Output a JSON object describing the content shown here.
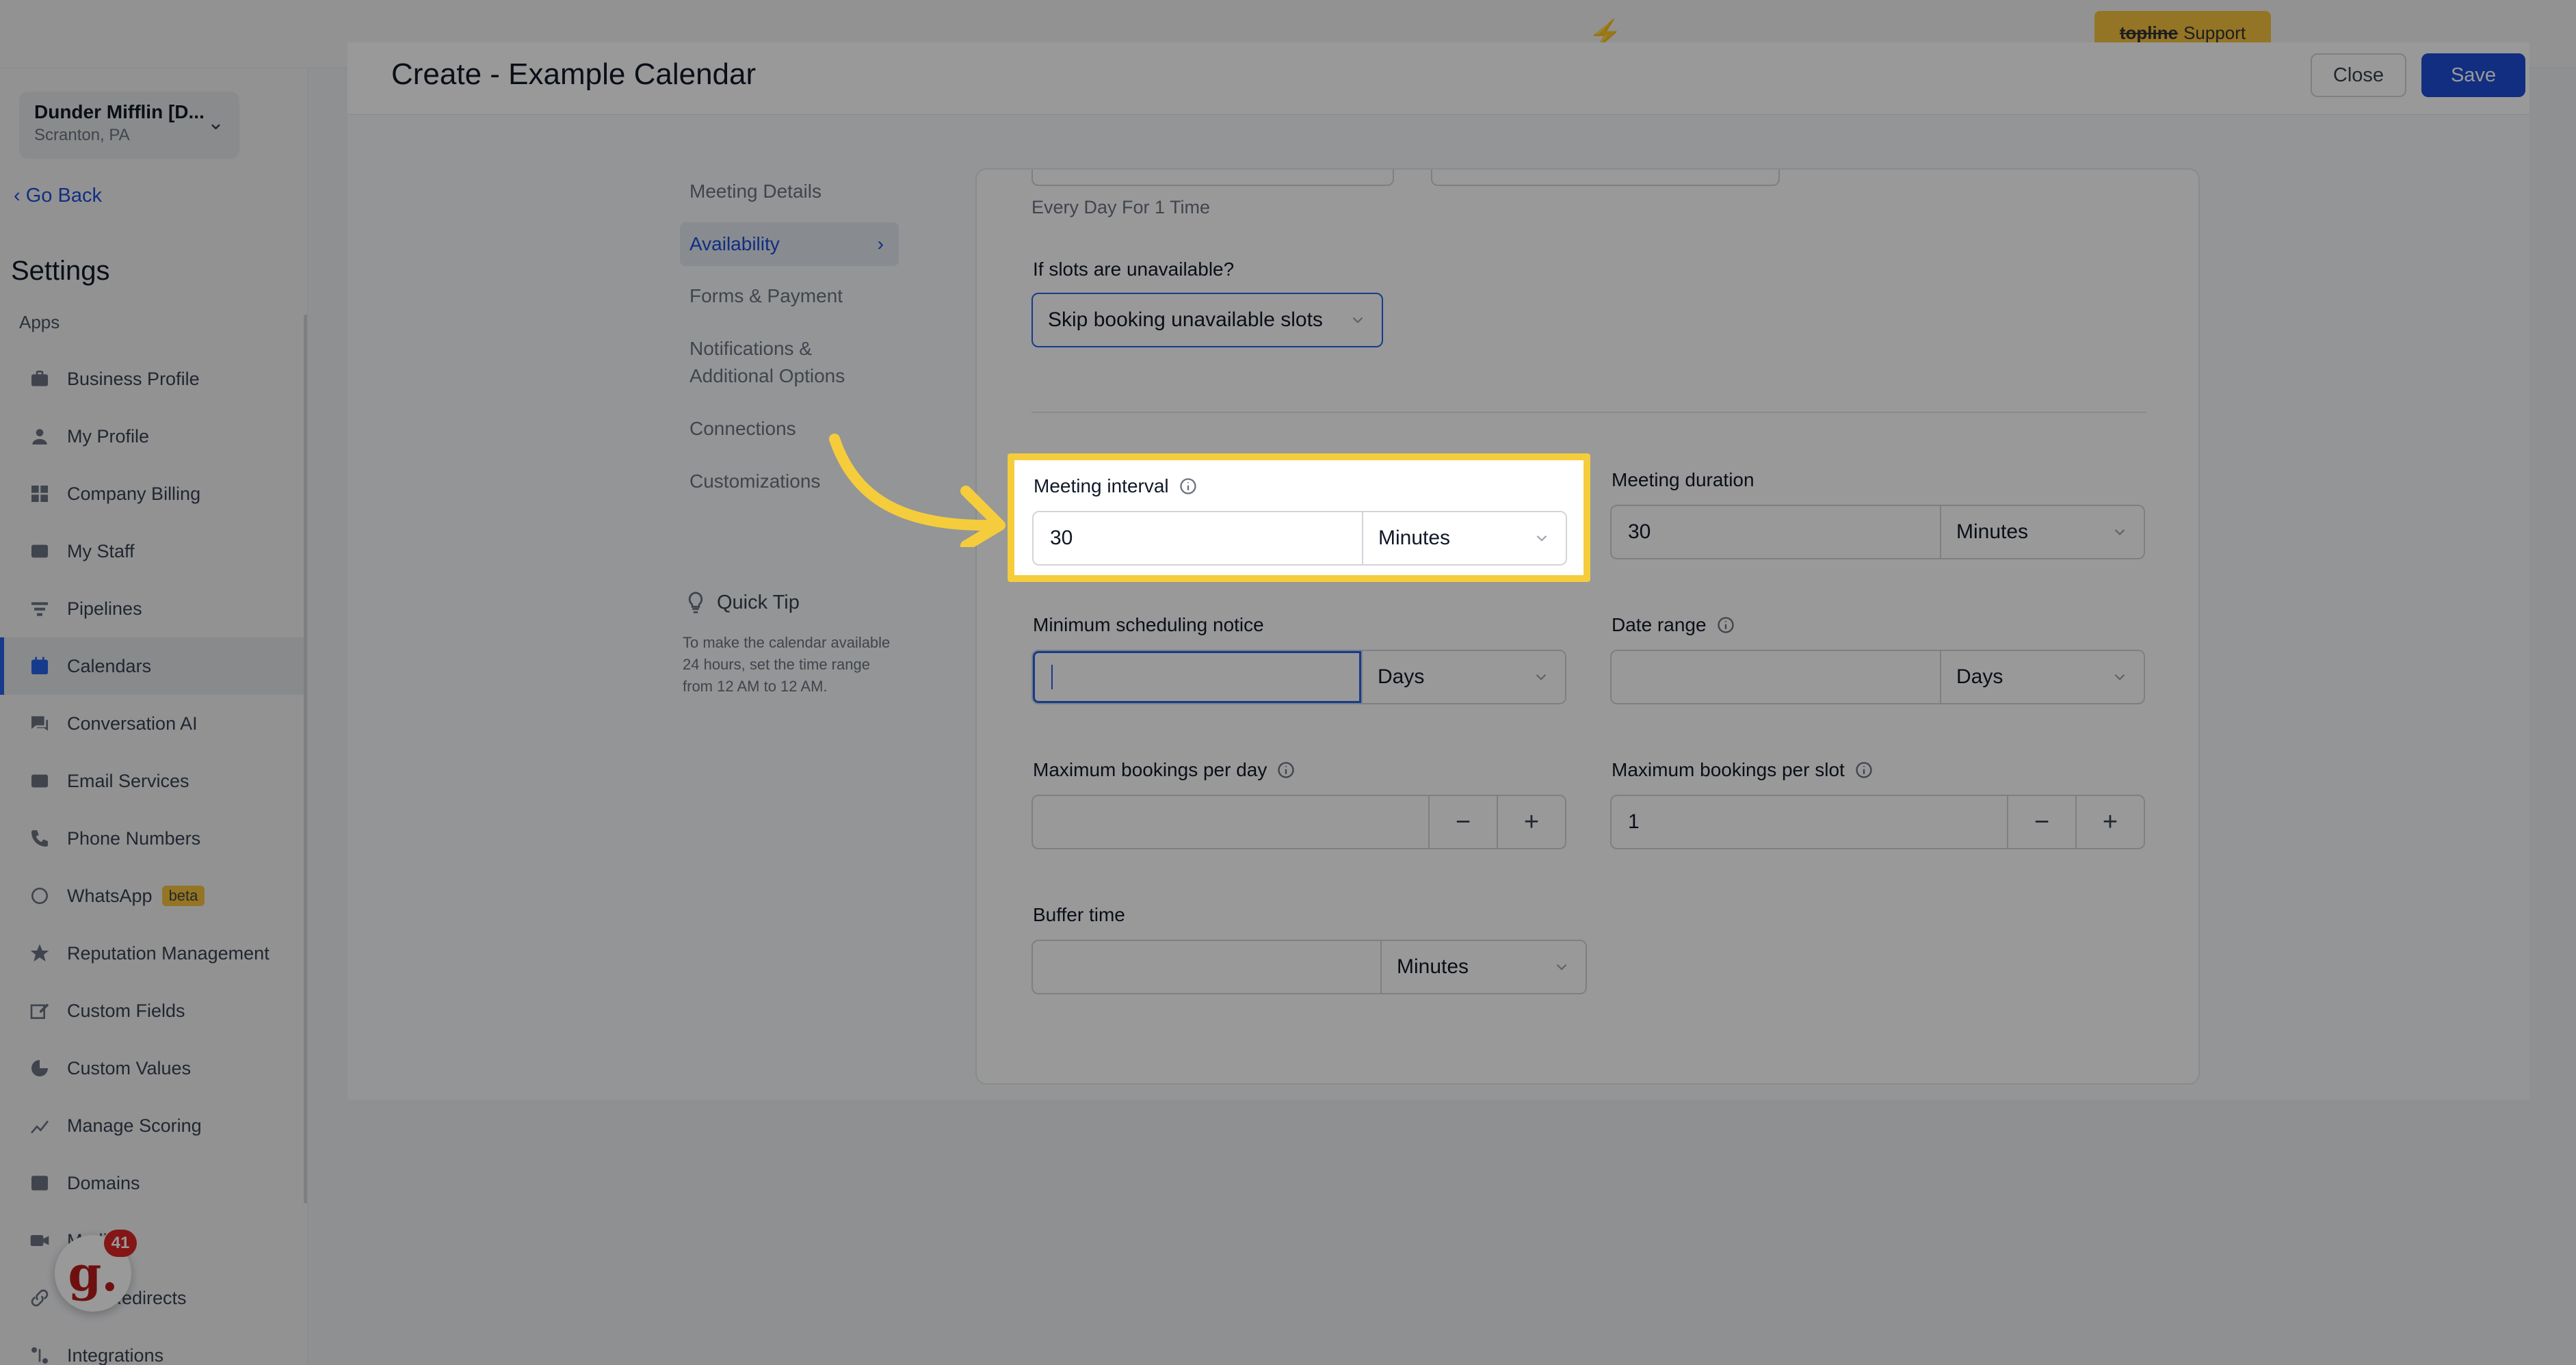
{
  "topbar": {
    "support": {
      "brand": "topline",
      "label": "Support"
    }
  },
  "sidebar": {
    "location": {
      "name": "Dunder Mifflin [D...",
      "city": "Scranton, PA"
    },
    "go_back": "Go Back",
    "settings_title": "Settings",
    "apps_label": "Apps",
    "items": [
      {
        "label": "Business Profile",
        "icon": "briefcase-icon"
      },
      {
        "label": "My Profile",
        "icon": "user-icon"
      },
      {
        "label": "Company Billing",
        "icon": "grid-icon"
      },
      {
        "label": "My Staff",
        "icon": "staff-icon"
      },
      {
        "label": "Pipelines",
        "icon": "filter-icon"
      },
      {
        "label": "Calendars",
        "icon": "calendar-icon",
        "active": true
      },
      {
        "label": "Conversation AI",
        "icon": "chat-icon"
      },
      {
        "label": "Email Services",
        "icon": "mail-icon"
      },
      {
        "label": "Phone Numbers",
        "icon": "phone-icon"
      },
      {
        "label": "WhatsApp",
        "icon": "whatsapp-icon",
        "badge": "beta"
      },
      {
        "label": "Reputation Management",
        "icon": "star-icon"
      },
      {
        "label": "Custom Fields",
        "icon": "edit-icon"
      },
      {
        "label": "Custom Values",
        "icon": "pie-icon"
      },
      {
        "label": "Manage Scoring",
        "icon": "chart-icon"
      },
      {
        "label": "Domains",
        "icon": "domain-icon"
      },
      {
        "label": "Media",
        "icon": "video-icon"
      },
      {
        "label": "URL Redirects",
        "icon": "link-icon"
      },
      {
        "label": "Integrations",
        "icon": "integrations-icon"
      }
    ],
    "widget": {
      "letter": "g.",
      "count": "41"
    }
  },
  "header": {
    "title": "Create - Example Calendar",
    "close_label": "Close",
    "save_label": "Save"
  },
  "config_menu": {
    "items": [
      "Meeting Details",
      "Availability",
      "Forms & Payment",
      "Notifications & Additional Options",
      "Connections",
      "Customizations"
    ],
    "active": "Availability"
  },
  "quick_tip": {
    "title": "Quick Tip",
    "text": "To make the calendar available 24 hours, set the time range from 12 AM to 12 AM."
  },
  "form": {
    "recurrence_text": "Every Day For 1 Time",
    "slots_unavailable_label": "If slots are unavailable?",
    "slots_unavailable_value": "Skip booking unavailable slots",
    "meeting_interval": {
      "label": "Meeting interval",
      "value": "30",
      "unit": "Minutes"
    },
    "meeting_duration": {
      "label": "Meeting duration",
      "value": "30",
      "unit": "Minutes"
    },
    "min_notice": {
      "label": "Minimum scheduling notice",
      "value": "",
      "unit": "Days"
    },
    "date_range": {
      "label": "Date range",
      "value": "",
      "unit": "Days"
    },
    "max_per_day": {
      "label": "Maximum bookings per day",
      "value": ""
    },
    "max_per_slot": {
      "label": "Maximum bookings per slot",
      "value": "1"
    },
    "buffer_time": {
      "label": "Buffer time",
      "value": "",
      "unit": "Minutes"
    },
    "minus": "−",
    "plus": "+"
  }
}
